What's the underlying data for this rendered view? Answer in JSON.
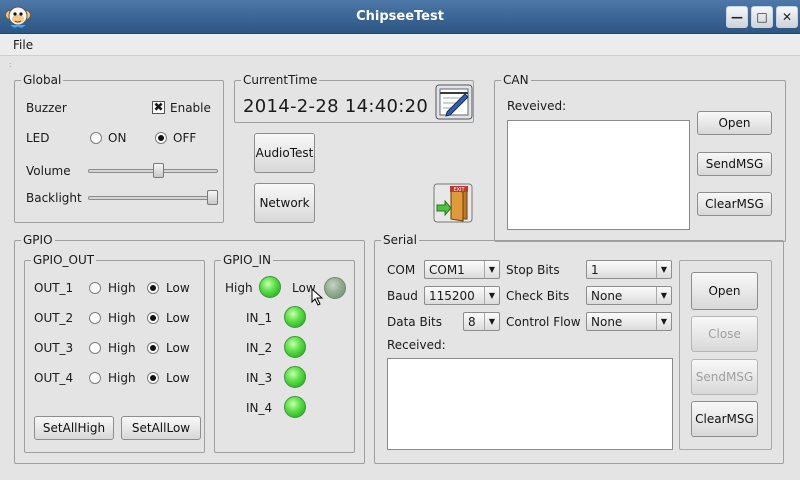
{
  "window": {
    "title": "ChipseeTest",
    "app_icon": "monkey-icon",
    "buttons": {
      "minimize": "minimize-icon",
      "maximize": "maximize-icon",
      "close": "close-icon"
    }
  },
  "menu": {
    "file": "File"
  },
  "global": {
    "title": "Global",
    "buzzer_label": "Buzzer",
    "enable_label": "Enable",
    "enable_checked": true,
    "led_label": "LED",
    "on_label": "ON",
    "off_label": "OFF",
    "led_state": "OFF",
    "volume_label": "Volume",
    "volume_level": 0.55,
    "backlight_label": "Backlight",
    "backlight_level": 1.0
  },
  "current_time": {
    "title": "CurrentTime",
    "value": "2014-2-28  14:40:20",
    "edit_icon": "notepad-edit-icon"
  },
  "buttons": {
    "audio_test": "AudioTest",
    "network": "Network",
    "exit_icon": "exit-door-icon"
  },
  "can": {
    "title": "CAN",
    "received_label": "Reveived:",
    "open": "Open",
    "send": "SendMSG",
    "clear": "ClearMSG"
  },
  "gpio": {
    "title": "GPIO",
    "out": {
      "title": "GPIO_OUT",
      "high_label": "High",
      "low_label": "Low",
      "rows": [
        {
          "name": "OUT_1",
          "state": "Low"
        },
        {
          "name": "OUT_2",
          "state": "Low"
        },
        {
          "name": "OUT_3",
          "state": "Low"
        },
        {
          "name": "OUT_4",
          "state": "Low"
        }
      ],
      "set_all_high": "SetAllHigh",
      "set_all_low": "SetAllLow"
    },
    "in": {
      "title": "GPIO_IN",
      "high_label": "High",
      "low_label": "Low",
      "rows": [
        {
          "name": "IN_1",
          "state": "High"
        },
        {
          "name": "IN_2",
          "state": "High"
        },
        {
          "name": "IN_3",
          "state": "High"
        },
        {
          "name": "IN_4",
          "state": "High"
        }
      ]
    }
  },
  "serial": {
    "title": "Serial",
    "com_label": "COM",
    "com_value": "COM1",
    "baud_label": "Baud",
    "baud_value": "115200",
    "data_bits_label": "Data Bits",
    "data_bits_value": "8",
    "stop_bits_label": "Stop  Bits",
    "stop_bits_value": "1",
    "check_bits_label": "Check Bits",
    "check_bits_value": "None",
    "flow_label": "Control Flow",
    "flow_value": "None",
    "received_label": "Received:",
    "open": "Open",
    "close": "Close",
    "send": "SendMSG",
    "clear": "ClearMSG"
  },
  "colors": {
    "titlebar": "#3a6494",
    "window_bg": "#e4e4e4",
    "led_on": "#4fd13e",
    "led_off": "#8aa488"
  }
}
